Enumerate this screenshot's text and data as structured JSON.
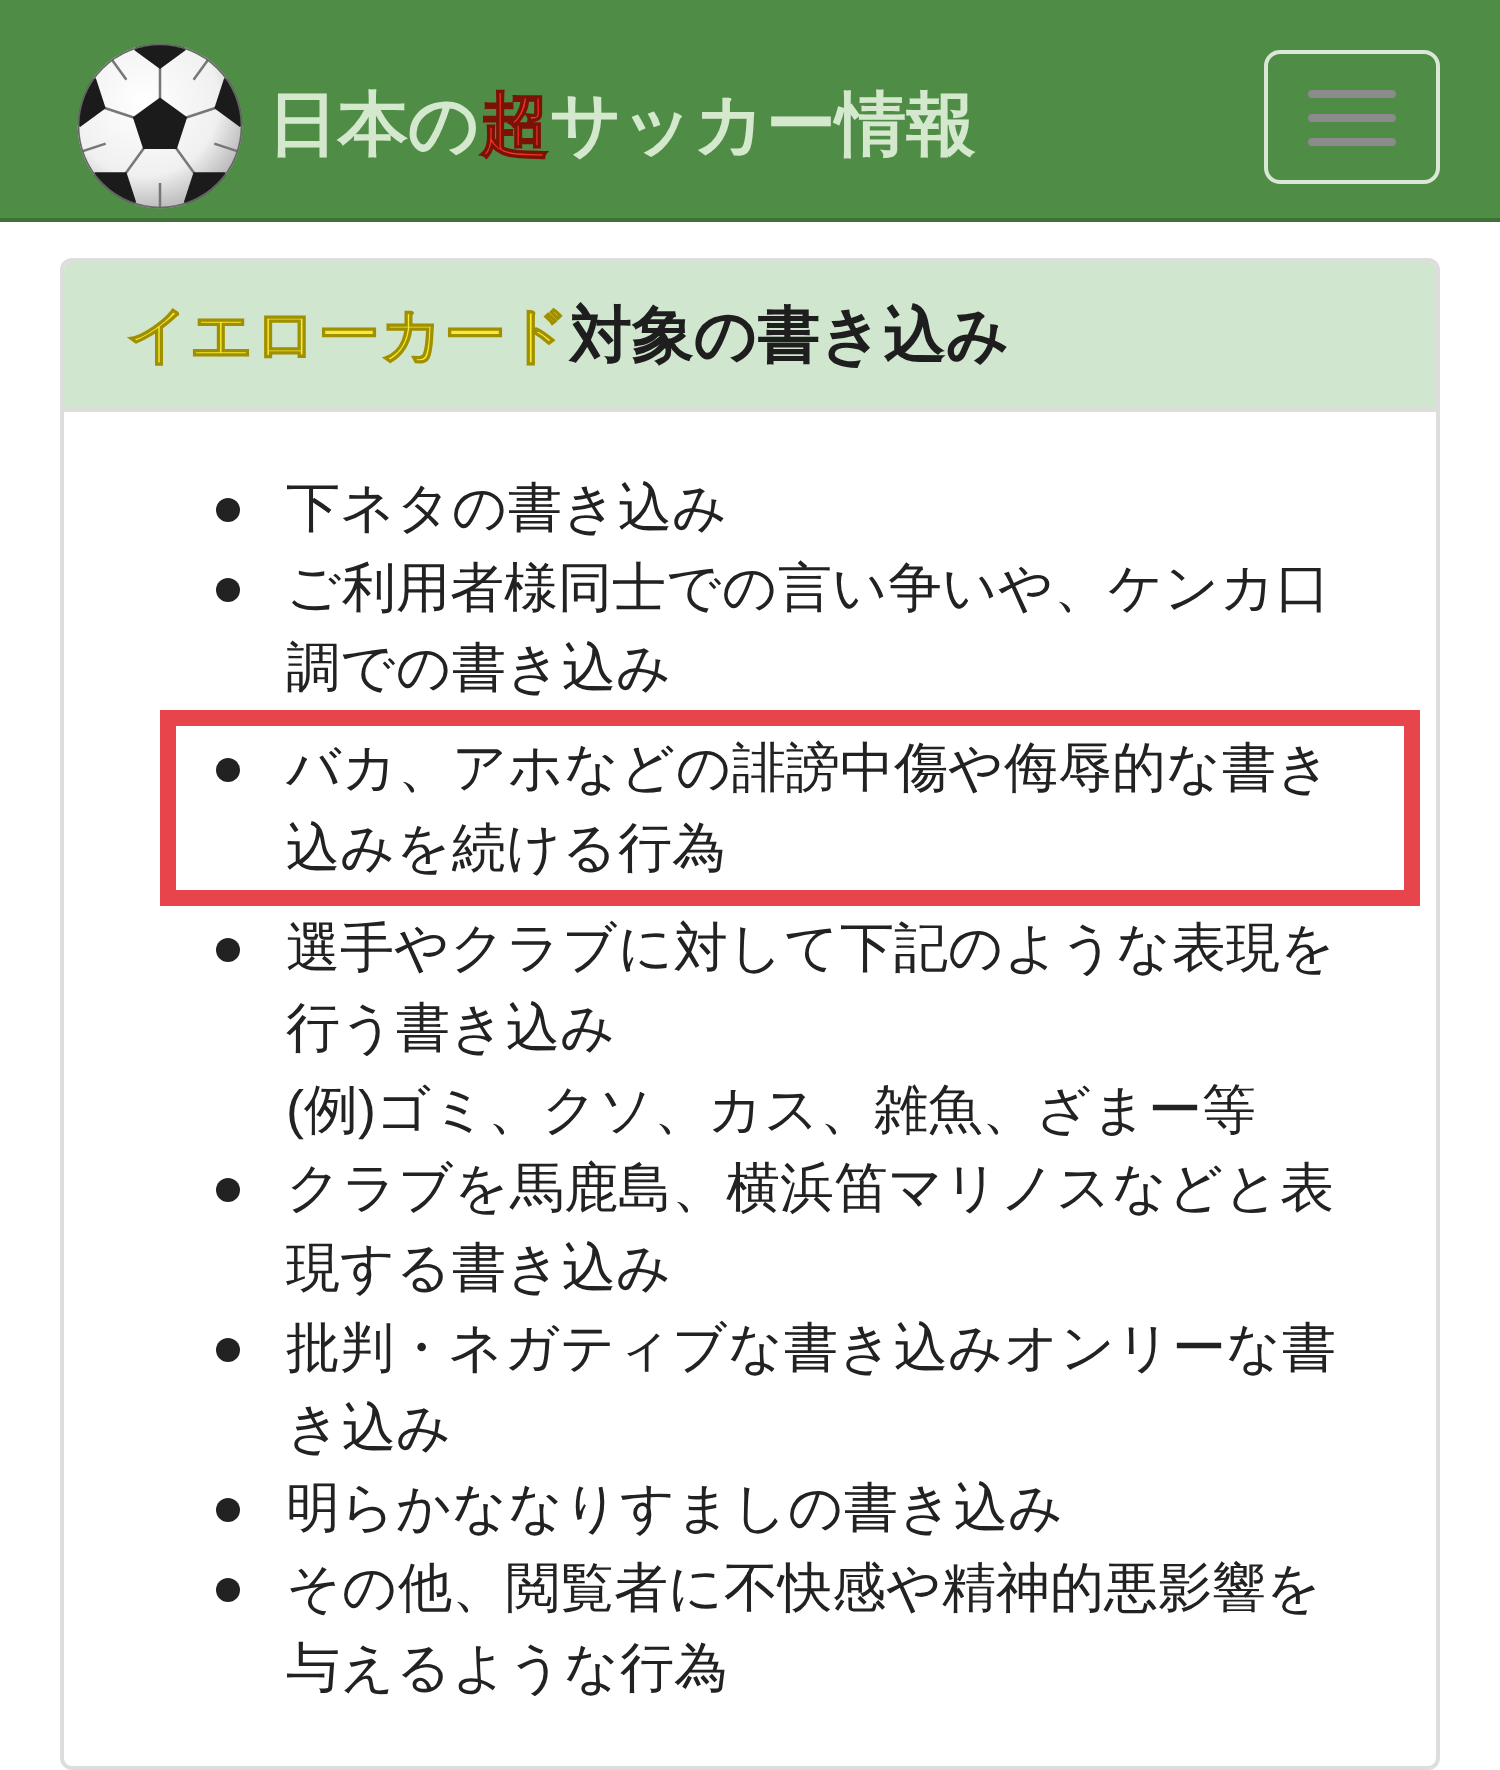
{
  "header": {
    "title": {
      "before": "日本の",
      "accent": "超",
      "after": "サッカー情報"
    }
  },
  "card": {
    "title": {
      "highlight": "イエローカード",
      "rest": "対象の書き込み"
    },
    "items": [
      {
        "text": "下ネタの書き込み",
        "highlighted": false
      },
      {
        "text": "ご利用者様同士での言い争いや、ケンカ口調での書き込み",
        "highlighted": false
      },
      {
        "text": "バカ、アホなどの誹謗中傷や侮辱的な書き込みを続ける行為",
        "highlighted": true
      },
      {
        "text": "選手やクラブに対して下記のような表現を行う書き込み",
        "note": "(例)ゴミ、クソ、カス、雑魚、ざまー等",
        "highlighted": false
      },
      {
        "text": "クラブを馬鹿島、横浜笛マリノスなどと表現する書き込み",
        "highlighted": false
      },
      {
        "text": "批判・ネガティブな書き込みオンリーな書き込み",
        "highlighted": false
      },
      {
        "text": "明らかななりすましの書き込み",
        "highlighted": false
      },
      {
        "text": "その他、閲覧者に不快感や精神的悪影響を与えるような行為",
        "highlighted": false
      }
    ]
  }
}
